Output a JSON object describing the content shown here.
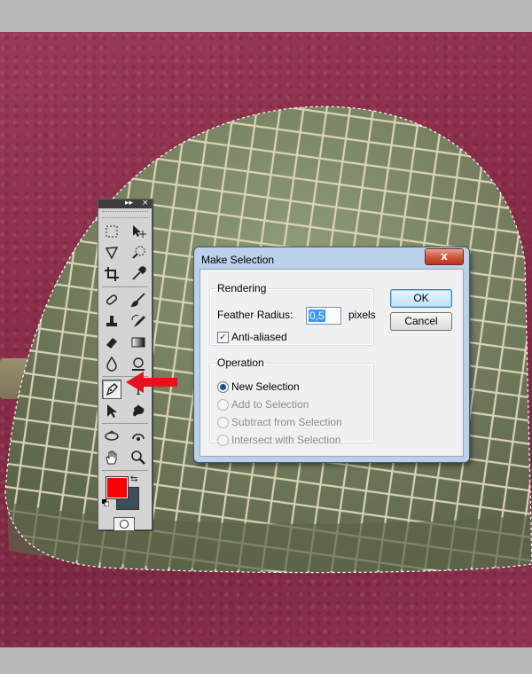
{
  "canvas": {
    "background": "#8a2d49"
  },
  "tools_panel": {
    "header_collapse": "▸▸",
    "header_close": "×",
    "foreground_color": "#ff0000",
    "background_color": "#3e4d5a",
    "tools": [
      [
        "marquee-icon",
        "move-icon"
      ],
      [
        "lasso-icon",
        "quick-selection-icon"
      ],
      [
        "crop-icon",
        "eyedropper-icon"
      ],
      [
        "spot-healing-icon",
        "brush-icon"
      ],
      [
        "clone-stamp-icon",
        "history-brush-icon"
      ],
      [
        "eraser-icon",
        "gradient-icon"
      ],
      [
        "blur-icon",
        "dodge-icon"
      ],
      [
        "pen-icon",
        "type-icon"
      ],
      [
        "path-selection-icon",
        "custom-shape-icon"
      ],
      [
        "3d-rotate-icon",
        "3d-orbit-icon"
      ],
      [
        "hand-icon",
        "zoom-icon"
      ]
    ],
    "active_tool": "pen-icon"
  },
  "dialog": {
    "title": "Make Selection",
    "close_label": "x",
    "rendering": {
      "legend": "Rendering",
      "feather_label": "Feather Radius:",
      "feather_value": "0,5",
      "feather_unit": "pixels",
      "antialiased_label": "Anti-aliased",
      "antialiased_checked": true
    },
    "operation": {
      "legend": "Operation",
      "options": [
        {
          "label": "New Selection",
          "selected": true,
          "enabled": true
        },
        {
          "label": "Add to Selection",
          "selected": false,
          "enabled": false
        },
        {
          "label": "Subtract from Selection",
          "selected": false,
          "enabled": false
        },
        {
          "label": "Intersect with Selection",
          "selected": false,
          "enabled": false
        }
      ]
    },
    "ok_label": "OK",
    "cancel_label": "Cancel"
  }
}
